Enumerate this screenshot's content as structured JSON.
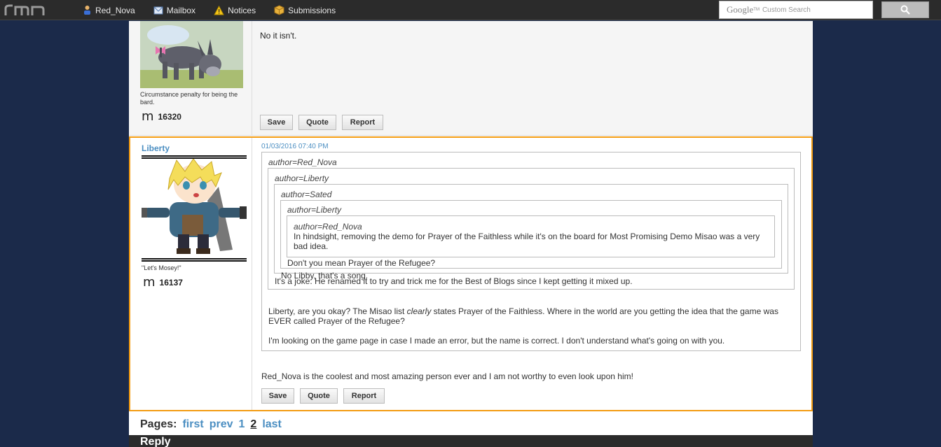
{
  "topbar": {
    "logo_text": "rmn",
    "nav": [
      {
        "label": "Red_Nova",
        "icon": "user-icon"
      },
      {
        "label": "Mailbox",
        "icon": "mail-icon"
      },
      {
        "label": "Notices",
        "icon": "warning-icon"
      },
      {
        "label": "Submissions",
        "icon": "box-icon"
      }
    ],
    "search": {
      "brand": "Google",
      "brand_sup": "TM",
      "placeholder": "Custom Search"
    }
  },
  "post1": {
    "caption": "Circumstance penalty for being the bard.",
    "points": "16320",
    "body": "No it isn't.",
    "buttons": {
      "save": "Save",
      "quote": "Quote",
      "report": "Report"
    }
  },
  "post2": {
    "username": "Liberty",
    "caption": "\"Let's Mosey!\"",
    "points": "16137",
    "date": "01/03/2016 07:40 PM",
    "quotes": {
      "q1_author": "author=Red_Nova",
      "q2_author": "author=Liberty",
      "q3_author": "author=Sated",
      "q4_author": "author=Liberty",
      "q5_author": "author=Red_Nova",
      "q5_text": "In hindsight, removing the demo for Prayer of the Faithless while it's on the board for Most Promising Demo Misao was a very bad idea.",
      "q4_text": "Don't you mean Prayer of the Refugee?",
      "q3_text": "No Libby, that's a song.",
      "q2_text": "It's a joke. He renamed it to try and trick me for the Best of Blogs since I kept getting it mixed up.",
      "q1_text_a": "Liberty, are you okay? The Misao list ",
      "q1_text_em": "clearly",
      "q1_text_b": " states Prayer of the Faithless. Where in the world are you getting the idea that the game was EVER called Prayer of the Refugee?",
      "q1_text_c": "I'm looking on the game page in case I made an error, but the name is correct. I don't understand what's going on with you."
    },
    "body": "Red_Nova is the coolest and most amazing person ever and I am not worthy to even look upon him!",
    "buttons": {
      "save": "Save",
      "quote": "Quote",
      "report": "Report"
    }
  },
  "pagination": {
    "label": "Pages:",
    "links": [
      "first",
      "prev",
      "1",
      "2",
      "last"
    ],
    "current": "2"
  },
  "reply": {
    "label": "Reply"
  },
  "colors": {
    "accent": "#4c8fc2",
    "highlight_border": "#f39c12",
    "background": "#1b2a4a"
  }
}
